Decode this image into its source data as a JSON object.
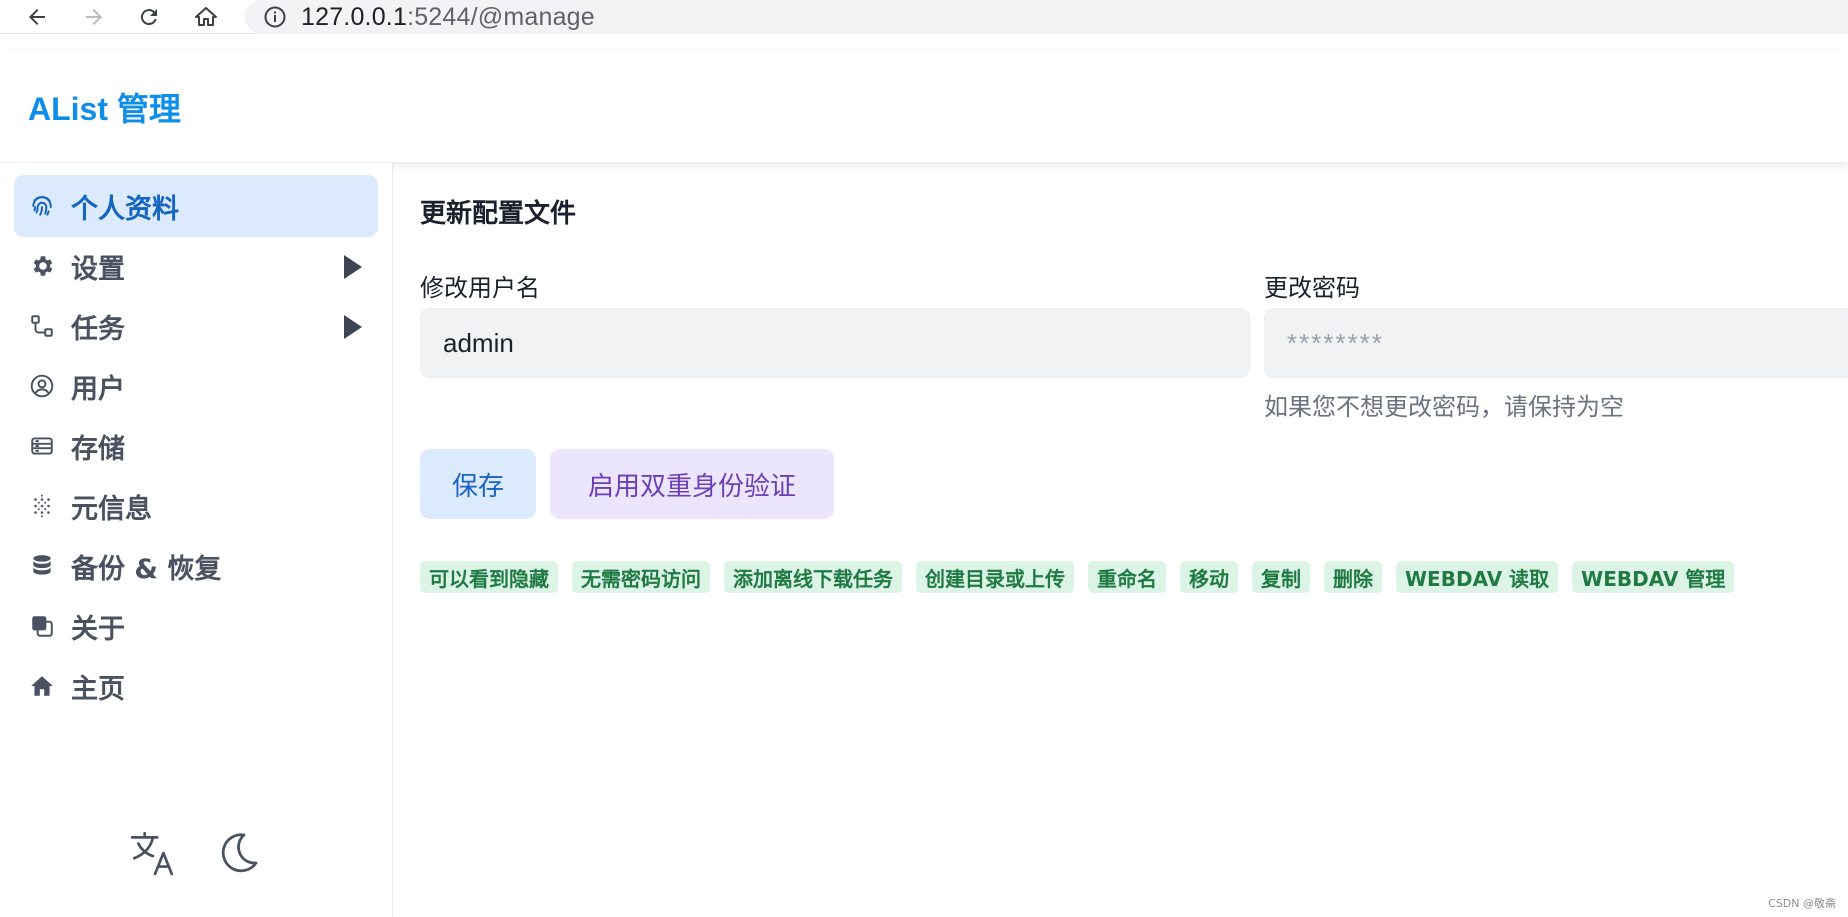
{
  "browser": {
    "url_host": "127.0.0.1",
    "url_rest": ":5244/@manage",
    "icons": [
      "back-icon",
      "forward-icon",
      "reload-icon",
      "home-icon",
      "info-icon"
    ]
  },
  "app": {
    "title": "AList 管理",
    "accent": "#0e8ee9"
  },
  "sidebar": {
    "items": [
      {
        "label": "个人资料",
        "icon": "fingerprint-icon",
        "active": true
      },
      {
        "label": "设置",
        "icon": "gear-icon",
        "expandable": true
      },
      {
        "label": "任务",
        "icon": "workflow-icon",
        "expandable": true
      },
      {
        "label": "用户",
        "icon": "user-circle-icon"
      },
      {
        "label": "存储",
        "icon": "storage-icon"
      },
      {
        "label": "元信息",
        "icon": "metadata-icon"
      },
      {
        "label": "备份 & 恢复",
        "icon": "database-icon"
      },
      {
        "label": "关于",
        "icon": "about-icon"
      },
      {
        "label": "主页",
        "icon": "home-icon"
      }
    ],
    "footer": [
      "translate-icon",
      "moon-icon"
    ]
  },
  "profile": {
    "title": "更新配置文件",
    "username_label": "修改用户名",
    "username_value": "admin",
    "password_label": "更改密码",
    "password_placeholder": "********",
    "password_hint": "如果您不想更改密码，请保持为空",
    "save_label": "保存",
    "twofa_label": "启用双重身份验证",
    "permissions": [
      "可以看到隐藏",
      "无需密码访问",
      "添加离线下载任务",
      "创建目录或上传",
      "重命名",
      "移动",
      "复制",
      "删除",
      "WEBDAV 读取",
      "WEBDAV 管理"
    ]
  },
  "watermark": "CSDN @敬斋"
}
